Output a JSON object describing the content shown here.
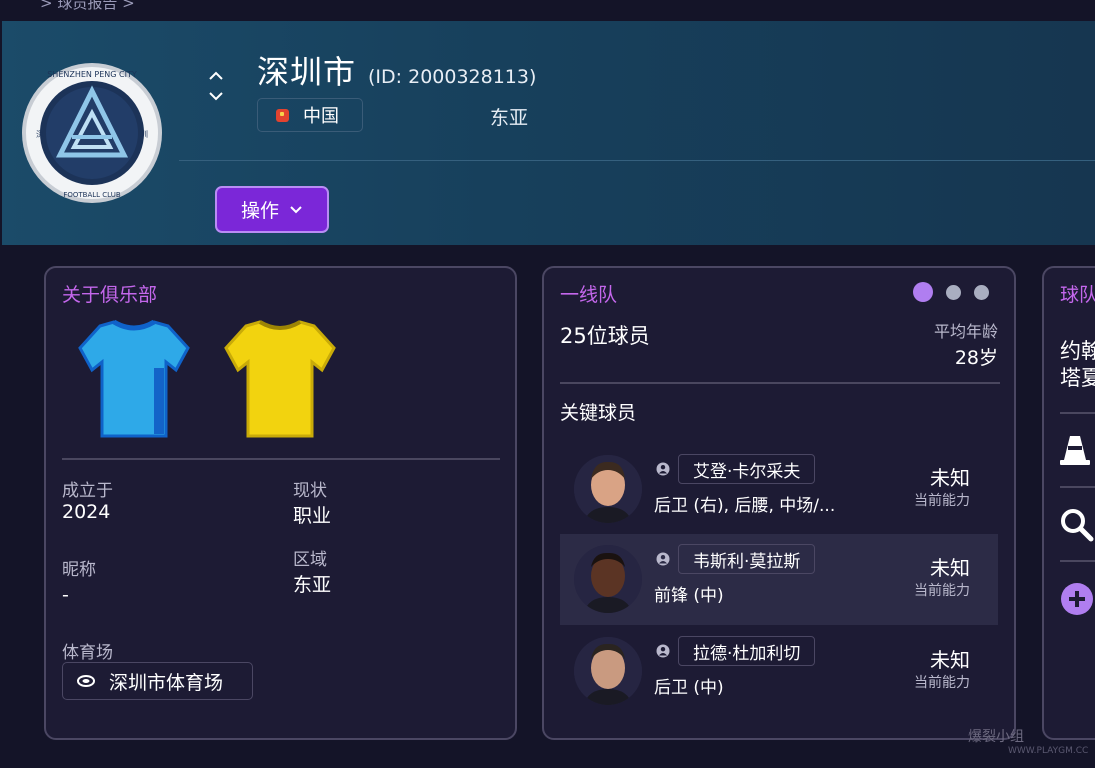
{
  "breadcrumb": "> 球员报告 >",
  "club": {
    "name": "深圳市",
    "id_text": "(ID: 2000328113)",
    "nation": "中国",
    "region": "东亚",
    "crest_name": "SHENZHEN PENG CITY",
    "crest_sub": "FOOTBALL CLUB",
    "crest_left": "深",
    "crest_right": "圳"
  },
  "actions": {
    "label": "操作"
  },
  "about": {
    "title": "关于俱乐部",
    "home_kit_color": "#2ea9e8",
    "away_kit_color": "#f2d30f",
    "founded_label": "成立于",
    "founded_value": "2024",
    "status_label": "现状",
    "status_value": "职业",
    "nickname_label": "昵称",
    "nickname_value": "-",
    "region_label": "区域",
    "region_value": "东亚",
    "stadium_label": "体育场",
    "stadium_value": "深圳市体育场"
  },
  "first_team": {
    "title": "一线队",
    "squad_count": "25位球员",
    "avg_age_label": "平均年龄",
    "avg_age_value": "28岁",
    "key_players_title": "关键球员",
    "players": [
      {
        "name": "艾登·卡尔采夫",
        "positions": "后卫 (右), 后腰, 中场/...",
        "ability": "未知",
        "ability_label": "当前能力"
      },
      {
        "name": "韦斯利·莫拉斯",
        "positions": "前锋 (中)",
        "ability": "未知",
        "ability_label": "当前能力"
      },
      {
        "name": "拉德·杜加利切",
        "positions": "后卫 (中)",
        "ability": "未知",
        "ability_label": "当前能力"
      }
    ]
  },
  "partial_card": {
    "title": "球队",
    "line1": "约翰",
    "line2": "塔夏"
  },
  "watermark": {
    "text": "爆裂小组",
    "url": "WWW.PLAYGM.CC"
  },
  "colors": {
    "accent": "#7b27d8",
    "title_purple": "#c467ec",
    "header_bg": "#1b4b69",
    "card_bg": "#1d1b34"
  }
}
